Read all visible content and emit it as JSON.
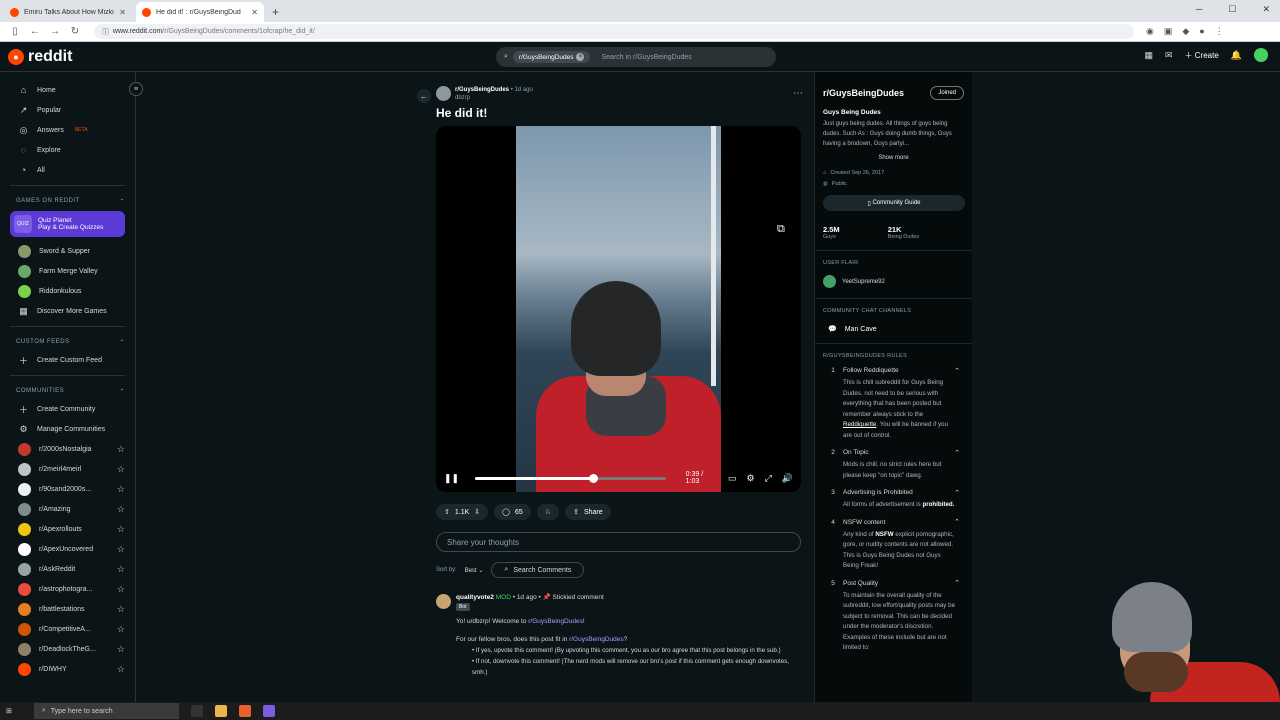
{
  "browser": {
    "tabs": [
      {
        "title": "Emiru Talks About How Mizkif G"
      },
      {
        "title": "He did it! : r/GuysBeingDud"
      }
    ],
    "new_tab": "+",
    "url_host": "www.reddit.com",
    "url_path": "/r/GuysBeingDudes/comments/1ofcrap/he_did_it/"
  },
  "header": {
    "logo": "reddit",
    "search_chip": "r/GuysBeingDudes",
    "search_placeholder": "Search in r/GuysBeingDudes",
    "create": "Create",
    "notif_count": "1"
  },
  "sidebar": {
    "nav": [
      {
        "label": "Home",
        "icon": "home-icon"
      },
      {
        "label": "Popular",
        "icon": "popular-icon"
      },
      {
        "label": "Answers",
        "beta": "BETA",
        "icon": "answers-icon"
      },
      {
        "label": "Explore",
        "icon": "explore-icon"
      },
      {
        "label": "All",
        "icon": "all-icon"
      }
    ],
    "games_heading": "GAMES ON REDDIT",
    "quiz_title": "Quiz Planet",
    "quiz_sub": "Play & Create Quizzes",
    "quiz_badge": "QUIZ",
    "games": [
      "Sword & Supper",
      "Farm Merge Valley",
      "Riddonkulous"
    ],
    "discover": "Discover More Games",
    "feeds_heading": "CUSTOM FEEDS",
    "create_feed": "Create Custom Feed",
    "communities_heading": "COMMUNITIES",
    "create_community": "Create Community",
    "manage_communities": "Manage Communities",
    "communities": [
      {
        "name": "r/2000sNostalgia",
        "color": "#c0392b"
      },
      {
        "name": "r/2meirl4meirl",
        "color": "#bdc3c7"
      },
      {
        "name": "r/90sand2000s...",
        "color": "#ecf0f1"
      },
      {
        "name": "r/Amazing",
        "color": "#7f8c8d"
      },
      {
        "name": "r/Apexrollouts",
        "color": "#f1c40f"
      },
      {
        "name": "r/ApexUncovered",
        "color": "#ffffff"
      },
      {
        "name": "r/AskReddit",
        "color": "#95a5a6"
      },
      {
        "name": "r/astrophotogra...",
        "color": "#e74c3c"
      },
      {
        "name": "r/battlestations",
        "color": "#e67e22"
      },
      {
        "name": "r/CompetitiveA...",
        "color": "#d35400"
      },
      {
        "name": "r/DeadlockTheG...",
        "color": "#8e8066"
      },
      {
        "name": "r/DIWHY",
        "color": "#ff4500"
      }
    ]
  },
  "post": {
    "subreddit": "r/GuysBeingDudes",
    "age": "• 1d ago",
    "author": "dbzrp",
    "title": "He did it!",
    "video_time": "0:39 / 1:03",
    "video_progress": 0.62,
    "upvotes": "1.1K",
    "comments": "65",
    "share": "Share",
    "thoughts_placeholder": "Share your thoughts",
    "sort_label": "Sort by:",
    "sort_value": "Best",
    "search_comments": "Search Comments"
  },
  "comment": {
    "author": "qualityvote2",
    "mod": "MOD",
    "age": "• 1d ago •",
    "stickied": "Stickied comment",
    "bot": "Bot",
    "line1_pre": "Yo! u/dbzrp! Welcome to ",
    "line1_link": "r/GuysBeingDudes",
    "line1_post": "!",
    "line2_pre": "For our fellow bros, does this post fit in ",
    "line2_link": "r/GuysBeingDudes",
    "line2_post": "?",
    "bullet1": "If yes, upvote this comment! (By upvoting this comment, you as our bro agree that this post belongs in the sub.)",
    "bullet2": "If not, downvote this comment! (The nerd mods will remove our bro's post if this comment gets enough downvotes, smh.)"
  },
  "right": {
    "name": "r/GuysBeingDudes",
    "joined": "Joined",
    "tagline": "Guys Being Dudes",
    "desc": "Just guys being dudes. All things of guys being dudes. Such As : Guys doing dumb things, Guys having a brodown, Guys partyi...",
    "show_more": "Show more",
    "created": "Created Sep 26, 2017",
    "visibility": "Public",
    "guide": "Community Guide",
    "stat1_n": "2.5M",
    "stat1_l": "Guys",
    "stat2_n": "21K",
    "stat2_l": "Being Dudes",
    "flair_heading": "USER FLAIR",
    "flair_user": "YeetSupreme92",
    "chat_heading": "COMMUNITY CHAT CHANNELS",
    "chat": "Man Cave",
    "rules_heading": "R/GUYSBEINGDUDES RULES",
    "rules": [
      {
        "num": "1",
        "title": "Follow Reddiquette",
        "body_pre": "This is chill subreddit for Guys Being Dudes. not need to be serious with everything that has been posted but remember always stick to the ",
        "body_link": "Reddiquette",
        "body_post": ". You will be banned if you are out of control."
      },
      {
        "num": "2",
        "title": "On Topic",
        "body_pre": "Mods is chill. no strict rules here but please keep \"on topic\" dawg."
      },
      {
        "num": "3",
        "title": "Advertising is Prohibited",
        "body_pre": "All forms of advertisement is ",
        "body_bold": "prohibited."
      },
      {
        "num": "4",
        "title": "NSFW content",
        "body_pre": "Any kind of ",
        "body_bold": "NSFW",
        "body_post": " explicit pornographic, gore, or nudity contents are not allowed. This is Guys Being Dudes not Guys Being Freak!"
      },
      {
        "num": "5",
        "title": "Post Quality",
        "body_pre": "To maintain the overall quality of the subreddit, low effort/quality posts may be subject to removal. This can be decided under the moderator's discretion. Examples of these include but are not limited to:"
      }
    ]
  },
  "taskbar": {
    "search": "Type here to search"
  }
}
